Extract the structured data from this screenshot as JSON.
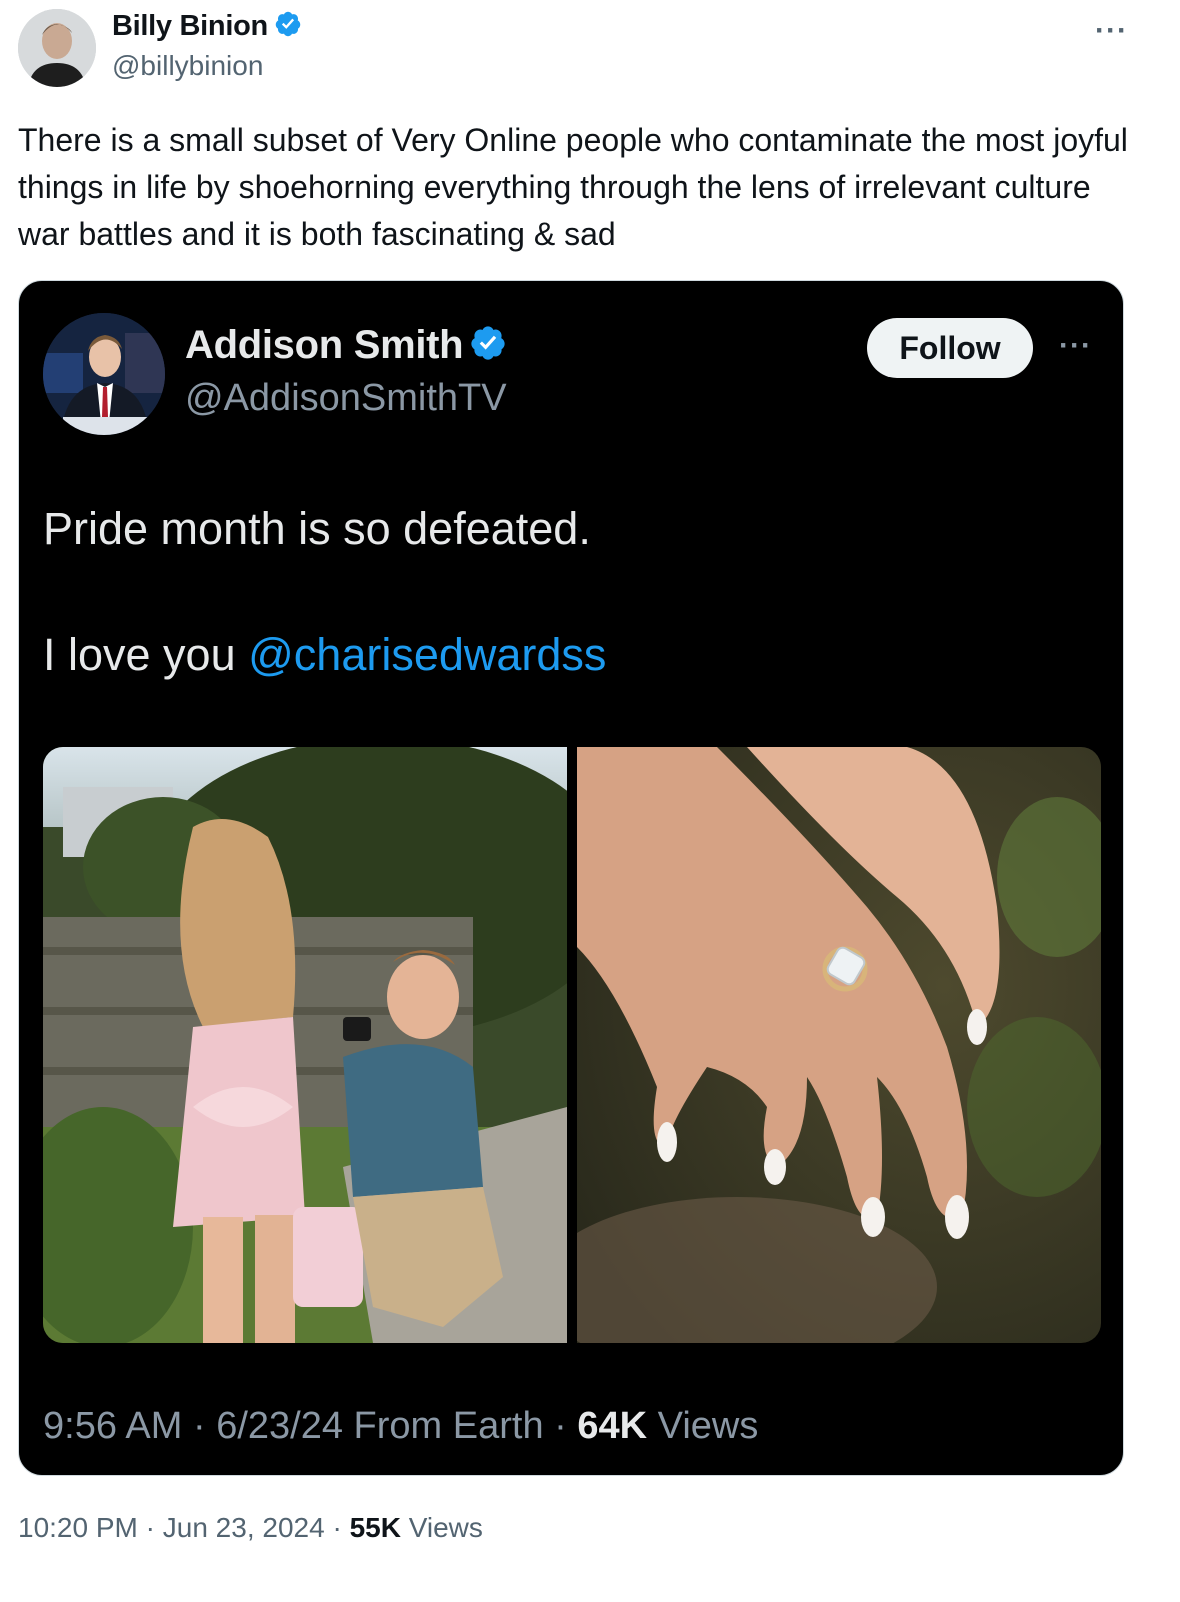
{
  "outer": {
    "name": "Billy Binion",
    "handle": "@billybinion",
    "more": "···",
    "text": "There is a small subset of Very Online people who contaminate the most joyful things in life by shoehorning everything through the lens of irrelevant culture war battles and it is both fascinating & sad",
    "time": "10:20 PM",
    "sep": "·",
    "date": "Jun 23, 2024",
    "views_count": "55K",
    "views_label": "Views"
  },
  "quote": {
    "name": "Addison Smith",
    "handle": "@AddisonSmithTV",
    "follow_label": "Follow",
    "more": "···",
    "line1": "Pride month is so defeated.",
    "line2_prefix": "I love you ",
    "mention": "@charisedwardss",
    "time": "9:56 AM",
    "sep": "·",
    "date": "6/23/24 From Earth",
    "views_count": "64K",
    "views_label": "Views"
  },
  "colors": {
    "verified": "#1d9bf0",
    "mention": "#1d9bf0",
    "card_bg": "#000000"
  },
  "icons": [
    "verified-badge-icon",
    "more-options-icon"
  ]
}
